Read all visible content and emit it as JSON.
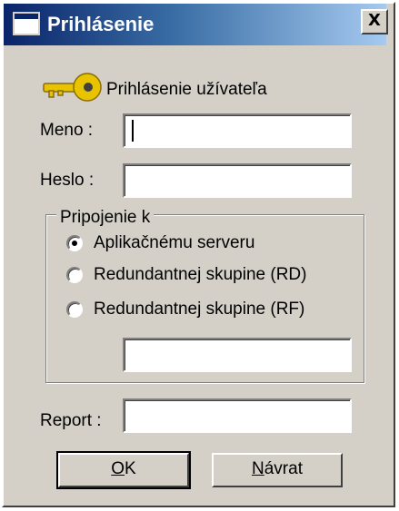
{
  "window": {
    "title": "Prihlásenie",
    "close_label": "X"
  },
  "header": {
    "icon": "key-icon",
    "title": "Prihlásenie užívateľa"
  },
  "form": {
    "name_label": "Meno :",
    "name_value": "",
    "password_label": "Heslo :",
    "password_value": "",
    "report_label": "Report :",
    "report_value": ""
  },
  "connection": {
    "legend": "Pripojenie k",
    "options": [
      {
        "label": "Aplikačnému serveru",
        "checked": true
      },
      {
        "label": "Redundantnej skupine (RD)",
        "checked": false
      },
      {
        "label": "Redundantnej skupine (RF)",
        "checked": false
      }
    ],
    "extra_value": ""
  },
  "buttons": {
    "ok_mnemonic": "O",
    "ok_rest": "K",
    "cancel_mnemonic": "N",
    "cancel_rest": "ávrat"
  },
  "colors": {
    "face": "#d4d0c8",
    "titlebar_start": "#0a246a",
    "titlebar_end": "#a6caf0",
    "key": "#e8c400"
  }
}
